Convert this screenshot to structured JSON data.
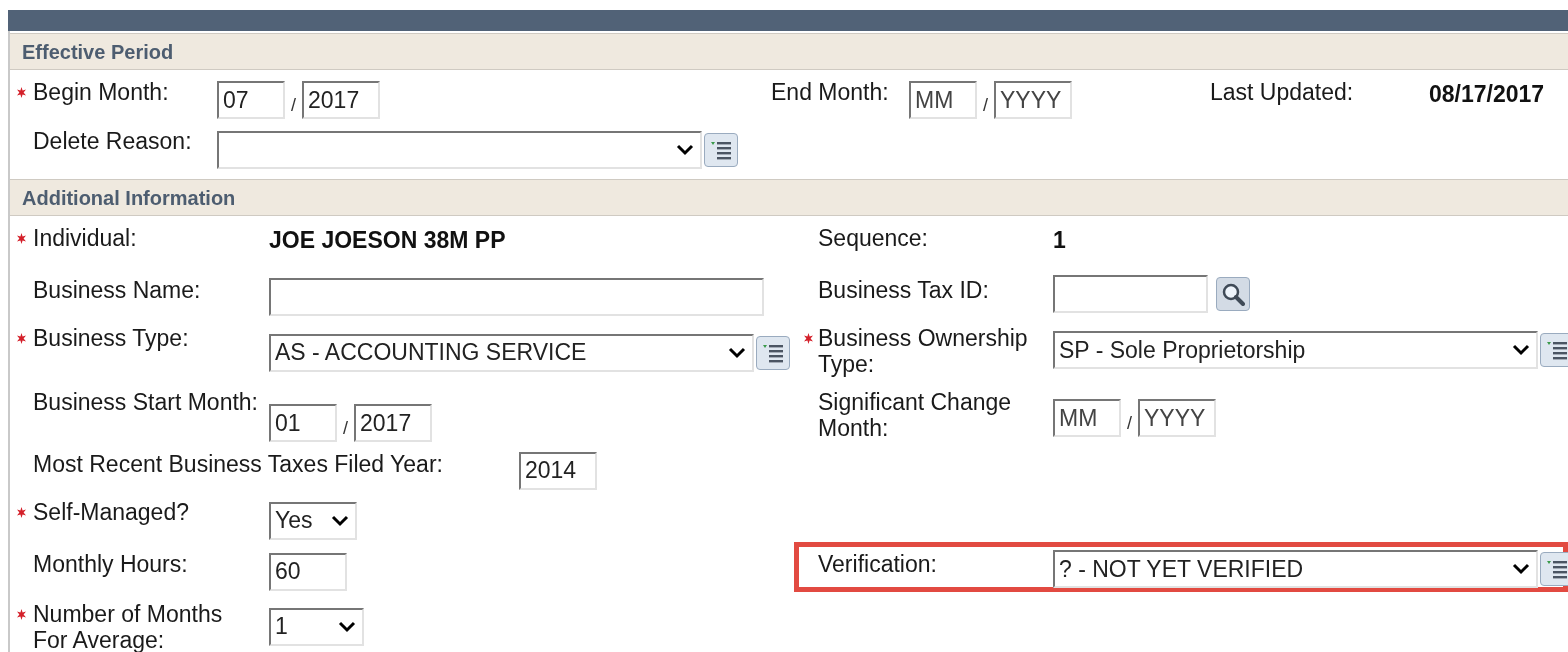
{
  "sections": [
    {
      "title": "Effective Period",
      "rows": [
        {
          "cells": [
            {
              "label": "Begin Month:",
              "required": true,
              "kind": "date",
              "month": {
                "value": "07"
              },
              "separator": "/",
              "year": {
                "value": "2017"
              }
            },
            {
              "label": "End Month:",
              "required": false,
              "kind": "date",
              "month": {
                "placeholder": "MM"
              },
              "separator": "/",
              "year": {
                "placeholder": "YYYY"
              }
            },
            {
              "label": "Last Updated:",
              "required": false,
              "kind": "display",
              "value": "08/17/2017"
            }
          ]
        },
        {
          "cells": [
            {
              "label": "Delete Reason:",
              "required": false,
              "kind": "select",
              "list_button": true
            }
          ]
        }
      ]
    },
    {
      "title": "Additional Information",
      "rows": [
        {
          "cells": [
            {
              "label": "Individual:",
              "required": true,
              "kind": "display",
              "value": "JOE JOESON 38M PP"
            },
            {
              "label": "Sequence:",
              "required": false,
              "kind": "display",
              "value": "1"
            }
          ]
        },
        {
          "cells": [
            {
              "label": "Business Name:",
              "required": false,
              "kind": "text"
            },
            {
              "label": "Business Tax ID:",
              "required": false,
              "kind": "text",
              "search_button": true
            }
          ]
        },
        {
          "cells": [
            {
              "label": "Business Type:",
              "required": true,
              "kind": "select",
              "value": "AS - ACCOUNTING SERVICE",
              "list_button": true
            },
            {
              "label": "Business Ownership Type:",
              "required": true,
              "kind": "select",
              "value": "SP - Sole Proprietorship",
              "list_button": true
            }
          ]
        },
        {
          "cells": [
            {
              "label": "Business Start Month:",
              "required": false,
              "kind": "date",
              "month": {
                "value": "01"
              },
              "separator": "/",
              "year": {
                "value": "2017"
              }
            },
            {
              "label": "Significant Change Month:",
              "required": false,
              "kind": "date",
              "month": {
                "placeholder": "MM"
              },
              "separator": "/",
              "year": {
                "placeholder": "YYYY"
              }
            }
          ]
        },
        {
          "cells": [
            {
              "label": "Most Recent Business Taxes Filed Year:",
              "required": false,
              "kind": "text",
              "value": "2014",
              "wide": true
            }
          ]
        },
        {
          "cells": [
            {
              "label": "Self-Managed?",
              "required": true,
              "kind": "select",
              "value": "Yes"
            }
          ]
        },
        {
          "cells": [
            {
              "label": "Monthly Hours:",
              "required": false,
              "kind": "text",
              "value": "60"
            },
            {
              "label": "Verification:",
              "required": false,
              "kind": "select",
              "value": "? - NOT YET VERIFIED",
              "list_button": true,
              "highlighted": true
            }
          ]
        },
        {
          "cells": [
            {
              "label": "Number of Months For Average:",
              "required": true,
              "kind": "select",
              "value": "1"
            }
          ]
        }
      ]
    }
  ]
}
